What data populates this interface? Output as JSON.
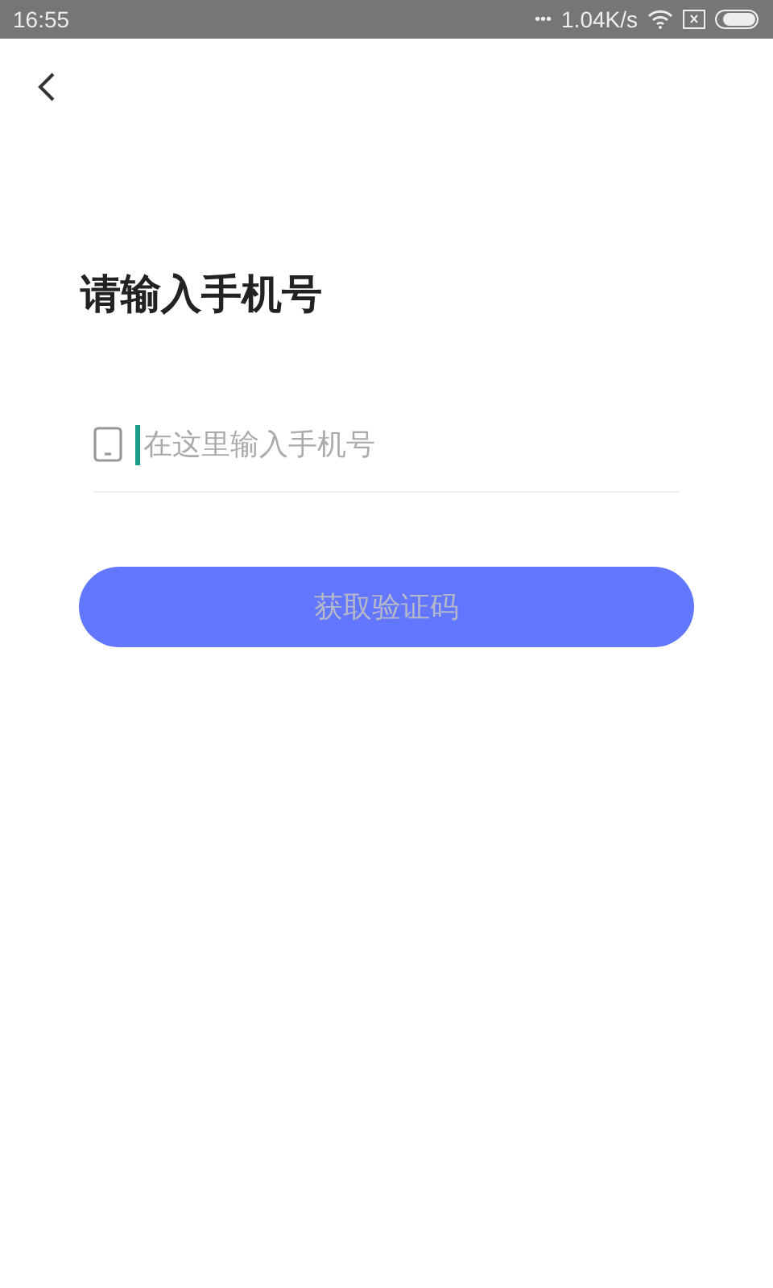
{
  "status_bar": {
    "time": "16:55",
    "dots": "•••",
    "speed": "1.04K/s"
  },
  "title": "请输入手机号",
  "phone_field": {
    "placeholder": "在这里输入手机号",
    "focused": true
  },
  "submit_button": {
    "label": "获取验证码",
    "disabled": true
  }
}
